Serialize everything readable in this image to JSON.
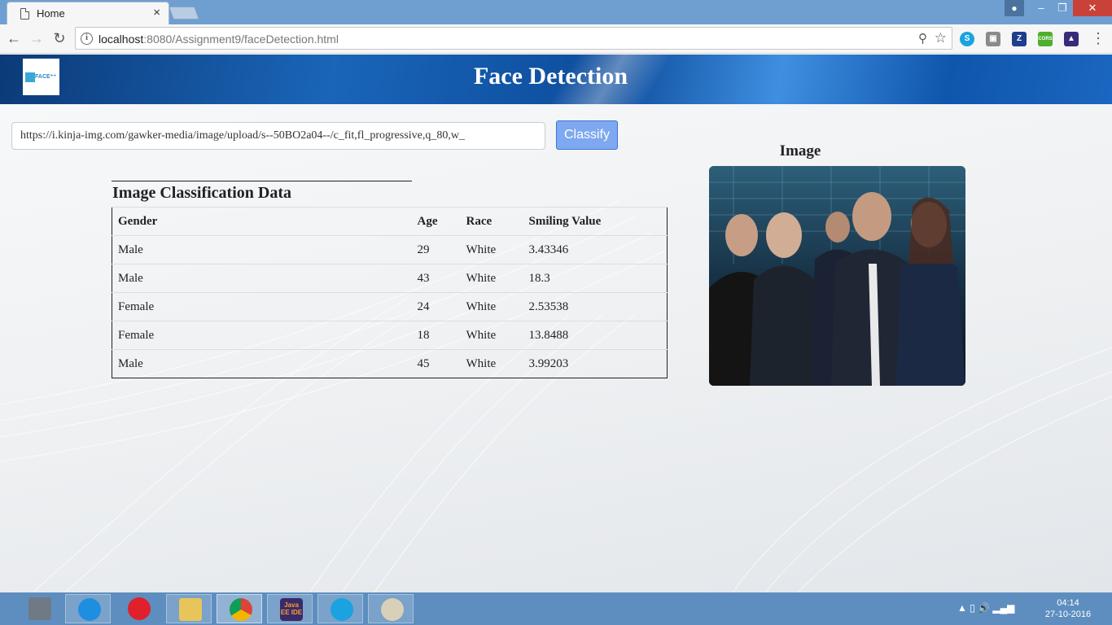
{
  "browser": {
    "tab_title": "Home",
    "tab_close": "×",
    "url_host": "localhost",
    "url_path": ":8080/Assignment9/faceDetection.html",
    "window_user_icon": "user-icon",
    "minimize": "–",
    "maximize": "❐",
    "close": "✕"
  },
  "extensions": [
    "skype-icon",
    "pocket-icon",
    "zotero-icon",
    "cors-icon",
    "purple-ext-icon"
  ],
  "extension_labels": {
    "zotero": "Z",
    "cors": "CORS"
  },
  "page": {
    "title": "Face Detection",
    "logo_text": "FACE⁺⁺",
    "url_input_value": "https://i.kinja-img.com/gawker-media/image/upload/s--50BO2a04--/c_fit,fl_progressive,q_80,w_",
    "classify_label": "Classify",
    "table_caption": "Image Classification Data",
    "image_heading": "Image",
    "accent_color": "#7ea8ef"
  },
  "table": {
    "headers": [
      "Gender",
      "Age",
      "Race",
      "Smiling Value"
    ],
    "rows": [
      [
        "Male",
        "29",
        "White",
        "3.43346"
      ],
      [
        "Male",
        "43",
        "White",
        "18.3"
      ],
      [
        "Female",
        "24",
        "White",
        "2.53538"
      ],
      [
        "Female",
        "18",
        "White",
        "13.8488"
      ],
      [
        "Male",
        "45",
        "White",
        "3.99203"
      ]
    ]
  },
  "taskbar": {
    "apps": [
      "laptop-icon",
      "internet-explorer-icon",
      "opera-icon",
      "file-explorer-icon",
      "chrome-icon",
      "eclipse-ide-icon",
      "skype-icon",
      "paint-icon"
    ],
    "eclipse_label": "Java EE IDE",
    "tray": "▲ ▯ 🔊 ▂▄▆",
    "time": "04:14",
    "date": "27-10-2016"
  }
}
